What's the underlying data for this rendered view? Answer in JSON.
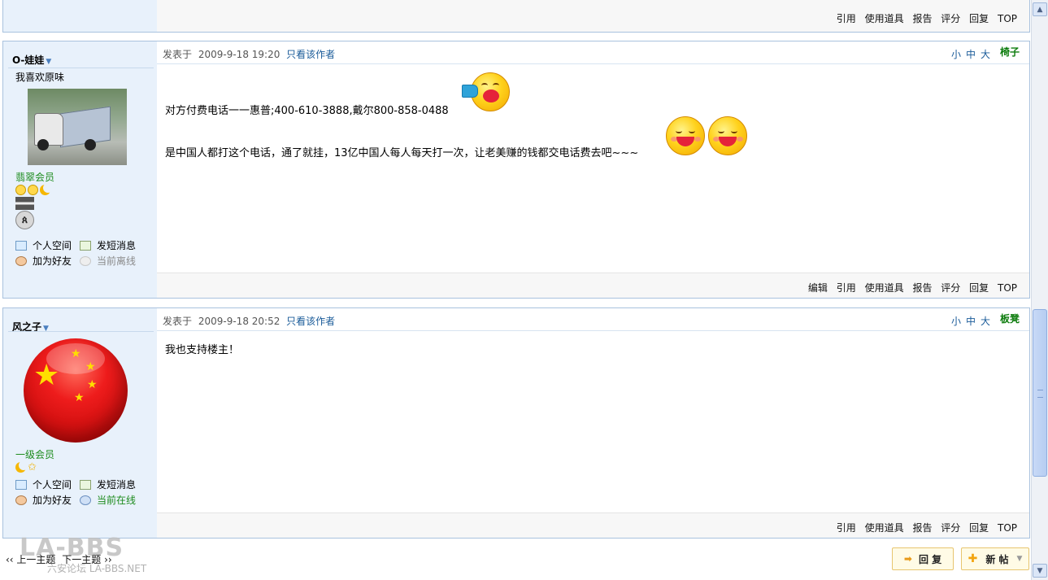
{
  "top_post": {
    "actions": [
      "引用",
      "使用道具",
      "报告",
      "评分",
      "回复",
      "TOP"
    ]
  },
  "posts": [
    {
      "username": "O-娃娃",
      "signature": "我喜欢原味",
      "rank": "翡翠会员",
      "avatar": "truck-photo",
      "meta_prefix": "发表于",
      "timestamp": "2009-9-18 19:20",
      "author_only": "只看该作者",
      "sizes": [
        "小",
        "中",
        "大"
      ],
      "floor": "椅子",
      "lines": [
        "对方付费电话一一惠普;400-610-3888,戴尔800-858-0488",
        "是中国人都打这个电话，通了就挂，13亿中国人每人每天打一次，让老美赚的钱都交电话费去吧~~~"
      ],
      "links": {
        "space": "个人空间",
        "pm": "发短消息",
        "friend": "加为好友",
        "status": "当前离线"
      },
      "actions": [
        "编辑",
        "引用",
        "使用道具",
        "报告",
        "评分",
        "回复",
        "TOP"
      ]
    },
    {
      "username": "风之子",
      "rank": "一级会员",
      "avatar": "china-flag-ball",
      "meta_prefix": "发表于",
      "timestamp": "2009-9-18 20:52",
      "author_only": "只看该作者",
      "sizes": [
        "小",
        "中",
        "大"
      ],
      "floor": "板凳",
      "lines": [
        "我也支持楼主！"
      ],
      "links": {
        "space": "个人空间",
        "pm": "发短消息",
        "friend": "加为好友",
        "status": "当前在线"
      },
      "actions": [
        "引用",
        "使用道具",
        "报告",
        "评分",
        "回复",
        "TOP"
      ]
    }
  ],
  "footer": {
    "prev": "‹‹ 上一主题",
    "next": "下一主题 ››",
    "reply_button": "回 复",
    "new_post_button": "新 帖",
    "watermark": "LA-BBS",
    "watermark_sub": "六安论坛 LA-BBS.NET"
  },
  "colors": {
    "border": "#a9c2de",
    "sidebar": "#e8f1fb",
    "floor": "#0d7c0d",
    "link": "#1a5b99",
    "rank": "#1c8b1c"
  }
}
